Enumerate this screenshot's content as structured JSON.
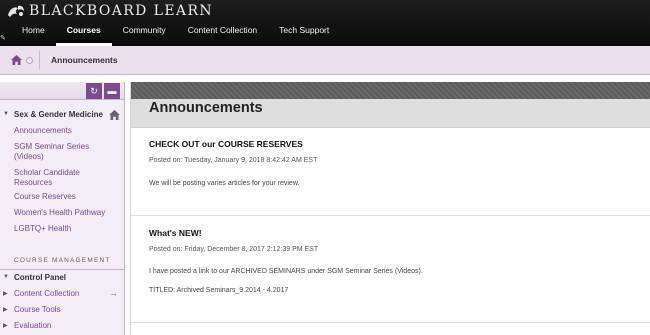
{
  "header": {
    "logo_text": "BLACKBOARD LEARN",
    "tabs": [
      {
        "label": "Home"
      },
      {
        "label": "Courses"
      },
      {
        "label": "Community"
      },
      {
        "label": "Content Collection"
      },
      {
        "label": "Tech Support"
      }
    ],
    "active_tab": "Courses"
  },
  "breadcrumb": {
    "current": "Announcements"
  },
  "sidebar": {
    "course_title": "Sex & Gender Medicine",
    "links": [
      {
        "label": "Announcements"
      },
      {
        "label": "SGM Seminar Series (Videos)"
      },
      {
        "label": "Scholar Candidate Resources"
      },
      {
        "label": "Course Reserves"
      },
      {
        "label": "Women's Health Pathway"
      },
      {
        "label": "LGBTQ+ Health"
      }
    ],
    "management_heading": "COURSE MANAGEMENT",
    "control_panel": {
      "label": "Control Panel",
      "items": [
        {
          "label": "Content Collection"
        },
        {
          "label": "Course Tools"
        },
        {
          "label": "Evaluation"
        }
      ]
    }
  },
  "main": {
    "page_title": "Announcements",
    "announcements": [
      {
        "title": "CHECK OUT our COURSE RESERVES",
        "posted": "Posted on: Tuesday, January 9, 2018 8:42:42 AM EST",
        "body": [
          "We will be posting varies articles for your review."
        ]
      },
      {
        "title": "What's NEW!",
        "posted": "Posted on: Friday, December 8, 2017 2:12:39 PM EST",
        "body": [
          "I have posted a link to our ARCHIVED SEMINARS under SGM Seminar Series  (Videos).",
          "TITLED: Archived Seminars_9.2014 - 4.2017"
        ]
      }
    ]
  },
  "colors": {
    "header_bg": "#111111",
    "breadcrumb_bg": "#eae0ee",
    "sidebar_bg": "#f3edf5",
    "accent_purple": "#7b4b8e",
    "link_purple": "#7b4b8e"
  },
  "icons": {
    "logo": "blackboard-logo-icon",
    "home": "home-icon",
    "refresh": "refresh-icon",
    "folder": "folder-icon",
    "arrow": "arrow-right-icon"
  }
}
